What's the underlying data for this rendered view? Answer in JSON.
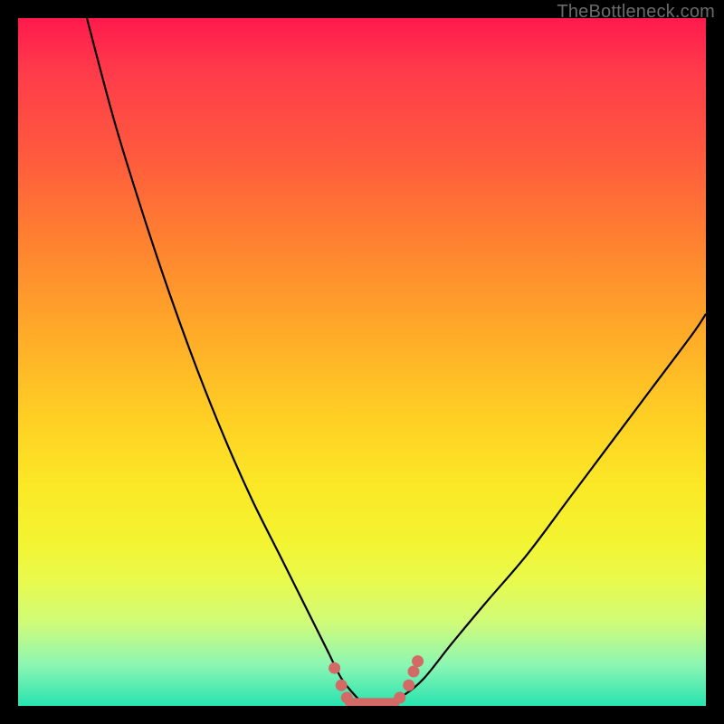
{
  "watermark": "TheBottleneck.com",
  "colors": {
    "background": "#000000",
    "gradient_top": "#ff1a4d",
    "gradient_bottom": "#28e3b0",
    "curve": "#000000",
    "marker": "#d36a65"
  },
  "chart_data": {
    "type": "line",
    "title": "",
    "xlabel": "",
    "ylabel": "",
    "xlim": [
      0,
      100
    ],
    "ylim": [
      0,
      100
    ],
    "series": [
      {
        "name": "left-curve",
        "x": [
          10,
          14,
          18,
          22,
          26,
          30,
          34,
          38,
          42,
          45,
          47,
          49,
          50
        ],
        "y": [
          100,
          85,
          72,
          60,
          49,
          39,
          30,
          22,
          14,
          8,
          4,
          1.5,
          0.5
        ]
      },
      {
        "name": "right-curve",
        "x": [
          54,
          56,
          59,
          63,
          68,
          74,
          80,
          86,
          92,
          98,
          100
        ],
        "y": [
          0.5,
          1.5,
          4,
          9,
          15,
          22,
          30,
          38,
          46,
          54,
          57
        ]
      },
      {
        "name": "valley-floor",
        "x": [
          47,
          56
        ],
        "y": [
          0.5,
          0.5
        ]
      }
    ],
    "markers": [
      {
        "x": 46.0,
        "y": 5.5
      },
      {
        "x": 47.0,
        "y": 3.0
      },
      {
        "x": 47.8,
        "y": 1.2
      },
      {
        "x": 55.5,
        "y": 1.2
      },
      {
        "x": 56.8,
        "y": 3.0
      },
      {
        "x": 57.5,
        "y": 5.0
      },
      {
        "x": 58.1,
        "y": 6.5
      }
    ],
    "flat_bar": {
      "x_start": 47.5,
      "x_end": 55.5,
      "y": 0.5,
      "height": 1.3
    }
  }
}
